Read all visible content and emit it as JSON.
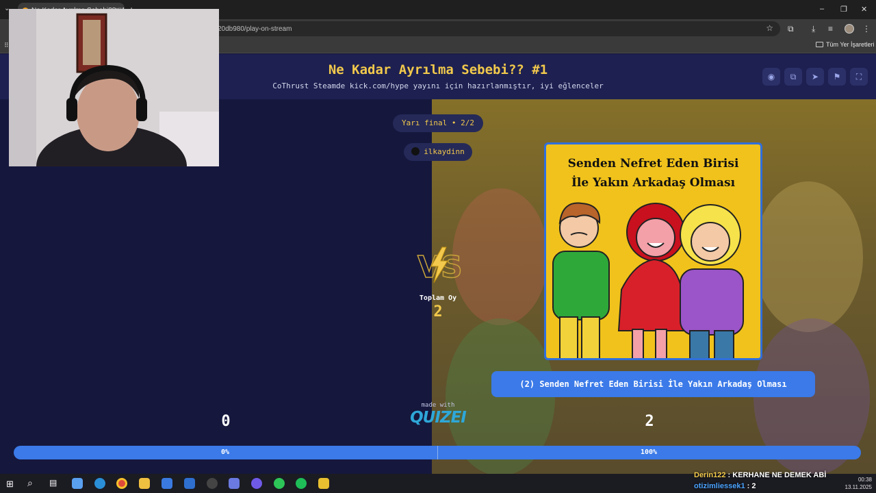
{
  "browser": {
    "tab_title": "Ne Kadar Ayrılma Sebebi?? #1",
    "tab_close": "×",
    "new_tab": "+",
    "url_visible": "20db980/play-on-stream",
    "bookmarks_folder": "Tüm Yer İşaretleri",
    "window_controls": [
      "–",
      "❐",
      "✕"
    ]
  },
  "page": {
    "title": "Ne Kadar Ayrılma Sebebi?? #1",
    "subtitle": "CoThrust Steamde kick.com/hype yayını için hazırlanmıştır, iyi eğlenceler",
    "header_buttons": [
      "eye-icon",
      "share-icon",
      "send-icon",
      "flag-icon",
      "fullscreen-icon"
    ],
    "round": "Yarı final • 2/2",
    "creator": "ilkaydinn",
    "total_votes_label": "Toplam Oy",
    "total_votes_value": "2",
    "card_title_line1": "Senden Nefret Eden Birisi",
    "card_title_line2": "İle Yakın Arkadaş Olması",
    "caption": "(2) Senden Nefret Eden Birisi İle Yakın Arkadaş Olması",
    "made_with": "made with",
    "brand": "QUIZEI",
    "score_left": "0",
    "score_right": "2",
    "bar_left_label": "0%",
    "bar_right_label": "100%",
    "bar_left_fraction": 0.0
  },
  "overlay": {
    "chat_user1": "Derin122",
    "chat_msg1": " : KERHANE NE DEMEK ABİ",
    "chat_user2": "otizimliessek1",
    "chat_msg2": " : 2"
  },
  "taskbar": {
    "time": "00:38",
    "date": "13.11.2025"
  },
  "colors": {
    "accent_yellow": "#f2c94c",
    "accent_blue": "#3b7ae8",
    "page_bg": "#15173d"
  }
}
